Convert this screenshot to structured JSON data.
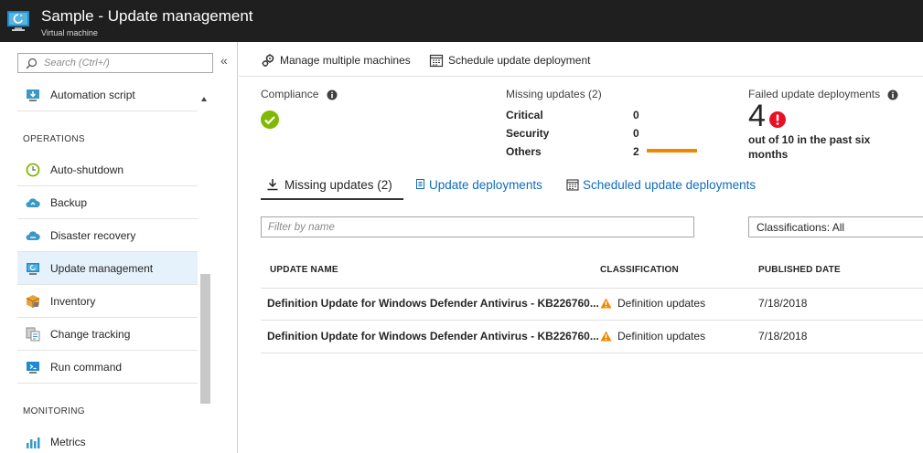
{
  "header": {
    "title": "Sample - Update management",
    "subtitle": "Virtual machine",
    "icon": "virtual-machine-update-icon"
  },
  "sidebar": {
    "search_placeholder": "Search (Ctrl+/)",
    "collapse_label": "«",
    "top_items": [
      {
        "label": "Automation script",
        "icon": "automation-script-icon"
      }
    ],
    "sections": [
      {
        "title": "OPERATIONS",
        "items": [
          {
            "label": "Auto-shutdown",
            "icon": "clock-icon"
          },
          {
            "label": "Backup",
            "icon": "cloud-backup-icon"
          },
          {
            "label": "Disaster recovery",
            "icon": "cloud-recovery-icon"
          },
          {
            "label": "Update management",
            "icon": "update-management-icon",
            "active": true
          },
          {
            "label": "Inventory",
            "icon": "inventory-box-icon"
          },
          {
            "label": "Change tracking",
            "icon": "change-tracking-icon"
          },
          {
            "label": "Run command",
            "icon": "run-command-icon"
          }
        ]
      },
      {
        "title": "MONITORING",
        "items": [
          {
            "label": "Metrics",
            "icon": "metrics-chart-icon"
          }
        ]
      }
    ]
  },
  "toolbar": {
    "manage_label": "Manage multiple machines",
    "schedule_label": "Schedule update deployment"
  },
  "summary": {
    "compliance_label": "Compliance",
    "compliance_status": "compliant",
    "missing_label": "Missing updates (2)",
    "missing_rows": [
      {
        "label": "Critical",
        "value": "0"
      },
      {
        "label": "Security",
        "value": "0"
      },
      {
        "label": "Others",
        "value": "2"
      }
    ],
    "failed_label": "Failed update deployments",
    "failed_count": "4",
    "failed_text": "out of 10 in the past six months"
  },
  "tabs": [
    {
      "label": "Missing updates (2)",
      "active": true,
      "icon": "download-icon"
    },
    {
      "label": "Update deployments",
      "active": false,
      "icon": "document-icon"
    },
    {
      "label": "Scheduled update deployments",
      "active": false,
      "icon": "calendar-icon"
    }
  ],
  "filter": {
    "placeholder": "Filter by name",
    "classifications_label": "Classifications: All"
  },
  "table": {
    "columns": [
      "UPDATE NAME",
      "CLASSIFICATION",
      "PUBLISHED DATE"
    ],
    "rows": [
      {
        "name": "Definition Update for Windows Defender Antivirus - KB226760...",
        "classification": "Definition updates",
        "date": "7/18/2018"
      },
      {
        "name": "Definition Update for Windows Defender Antivirus - KB226760...",
        "classification": "Definition updates",
        "date": "7/18/2018"
      }
    ]
  },
  "colors": {
    "titlebar_bg": "#1f1f1f",
    "link": "#0f6cbd",
    "compliant_green": "#7fba00",
    "error_red": "#e81123",
    "warning_orange": "#ee8a00",
    "active_item_bg": "#e5f1fb"
  }
}
